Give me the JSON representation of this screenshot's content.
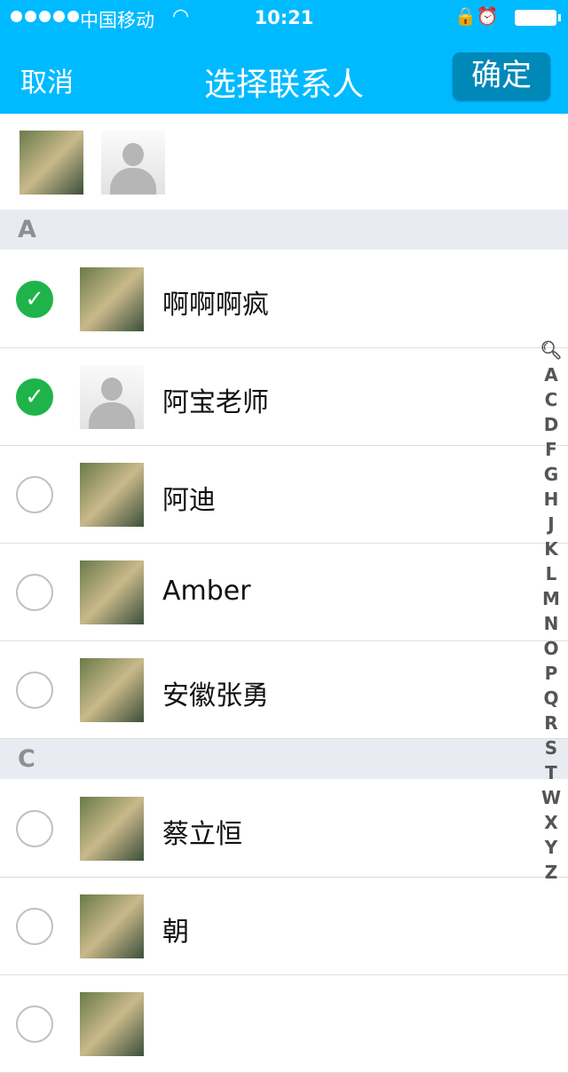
{
  "status_bar": {
    "carrier": "中国移动",
    "time": "10:21"
  },
  "nav": {
    "cancel": "取消",
    "title": "选择联系人",
    "confirm": "确定"
  },
  "selected_avatars": [
    {
      "type": "photo"
    },
    {
      "type": "placeholder"
    }
  ],
  "sections": [
    {
      "letter": "A",
      "contacts": [
        {
          "name": "啊啊啊疯",
          "checked": true,
          "avatar": "photo"
        },
        {
          "name": "阿宝老师",
          "checked": true,
          "avatar": "placeholder"
        },
        {
          "name": "阿迪",
          "checked": false,
          "avatar": "photo"
        },
        {
          "name": "Amber",
          "checked": false,
          "avatar": "photo"
        },
        {
          "name": "安徽张勇",
          "checked": false,
          "avatar": "photo"
        }
      ]
    },
    {
      "letter": "C",
      "contacts": [
        {
          "name": "蔡立恒",
          "checked": false,
          "avatar": "photo"
        },
        {
          "name": "朝",
          "checked": false,
          "avatar": "photo"
        },
        {
          "name": "",
          "checked": false,
          "avatar": "photo"
        }
      ]
    }
  ],
  "index": [
    "A",
    "C",
    "D",
    "F",
    "G",
    "H",
    "J",
    "K",
    "L",
    "M",
    "N",
    "O",
    "P",
    "Q",
    "R",
    "S",
    "T",
    "W",
    "X",
    "Y",
    "Z"
  ],
  "colors": {
    "header": "#00baff",
    "confirm_button": "#0088b8",
    "check": "#1fb44a",
    "section": "#e9ebf2"
  }
}
